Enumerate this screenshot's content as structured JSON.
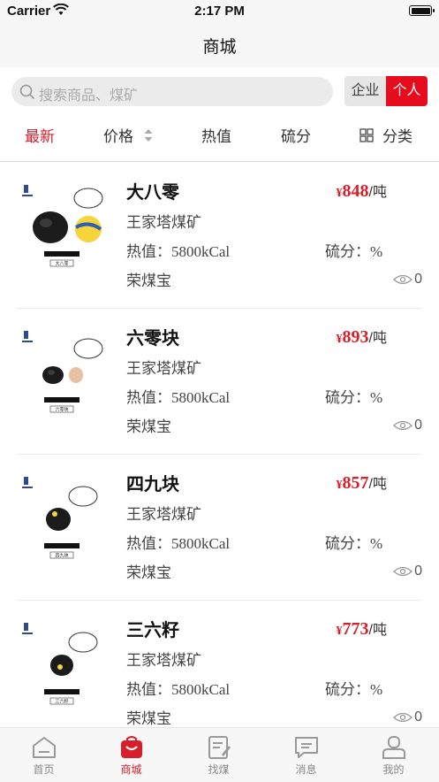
{
  "status_bar": {
    "carrier": "Carrier",
    "time": "2:17 PM"
  },
  "header": {
    "title": "商城"
  },
  "search": {
    "placeholder": "搜索商品、煤矿"
  },
  "segment": {
    "enterprise": "企业",
    "personal": "个人",
    "selected": "个人"
  },
  "filters": {
    "newest": "最新",
    "price": "价格",
    "heat": "热值",
    "sulfur": "硫分",
    "category": "分类",
    "active": "最新"
  },
  "products": [
    {
      "name": "大八零",
      "price_symbol": "¥",
      "price": "848",
      "unit": "/吨",
      "mine": "王家塔煤矿",
      "heat": "热值：5800kCal",
      "sulfur": "硫分：%",
      "seller": "荣煤宝",
      "views": "0",
      "thumb_label": "大八零"
    },
    {
      "name": "六零块",
      "price_symbol": "¥",
      "price": "893",
      "unit": "/吨",
      "mine": "王家塔煤矿",
      "heat": "热值：5800kCal",
      "sulfur": "硫分：%",
      "seller": "荣煤宝",
      "views": "0",
      "thumb_label": "六零块"
    },
    {
      "name": "四九块",
      "price_symbol": "¥",
      "price": "857",
      "unit": "/吨",
      "mine": "王家塔煤矿",
      "heat": "热值：5800kCal",
      "sulfur": "硫分：%",
      "seller": "荣煤宝",
      "views": "0",
      "thumb_label": "四九块"
    },
    {
      "name": "三六籽",
      "price_symbol": "¥",
      "price": "773",
      "unit": "/吨",
      "mine": "王家塔煤矿",
      "heat": "热值：5800kCal",
      "sulfur": "硫分：%",
      "seller": "荣煤宝",
      "views": "0",
      "thumb_label": "三六籽"
    }
  ],
  "tabbar": {
    "home": "首页",
    "mall": "商城",
    "find": "找煤",
    "messages": "消息",
    "mine": "我的",
    "active": "商城"
  },
  "colors": {
    "accent": "#d81e2a",
    "segment_active": "#e60c1e"
  }
}
